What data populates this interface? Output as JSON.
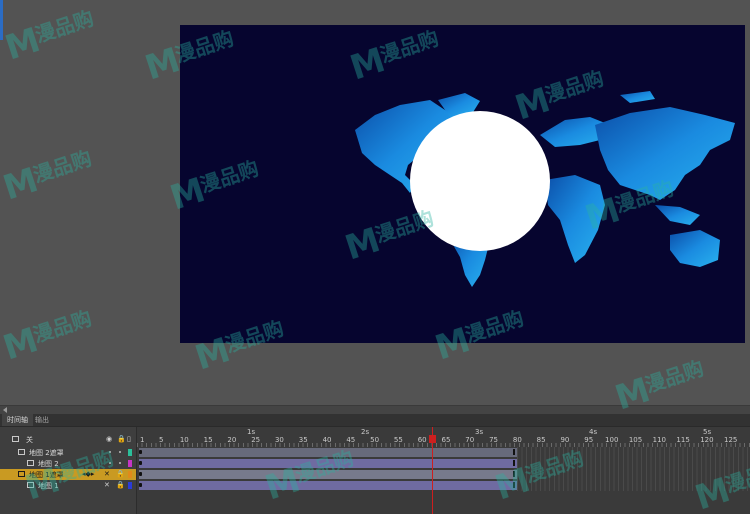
{
  "canvas": {
    "background": "#06052f",
    "circle_color": "#ffffff",
    "map_color": "#1e86d6"
  },
  "panel": {
    "tabs": [
      {
        "label": "时间轴"
      },
      {
        "label": "输出"
      }
    ]
  },
  "timeline": {
    "header_label": "关",
    "seconds": [
      "1s",
      "2s",
      "3s",
      "4s",
      "5s"
    ],
    "frame_numbers": [
      "1",
      "5",
      "10",
      "15",
      "20",
      "25",
      "30",
      "35",
      "40",
      "45",
      "50",
      "55",
      "60",
      "65",
      "70",
      "75",
      "80",
      "85",
      "90",
      "95",
      "100",
      "105",
      "110",
      "115",
      "120",
      "125"
    ],
    "layers": [
      {
        "name": "地图 2遮罩",
        "color": "#2bbf9a",
        "selected": false,
        "indent": 0
      },
      {
        "name": "地图 2",
        "color": "#c535c5",
        "selected": false,
        "indent": 1
      },
      {
        "name": "地图 1遮罩",
        "color": "#e08a1a",
        "selected": true,
        "indent": 0
      },
      {
        "name": "地图 1",
        "color": "#2a3bd8",
        "selected": false,
        "indent": 1
      }
    ],
    "span_colors": [
      "#676a7b",
      "#6f6ba1",
      "#777a8c",
      "#6f6ba1"
    ],
    "current_frame": 63,
    "last_frame": 80
  },
  "watermark": {
    "text": "漫品购",
    "color": "#2ab3a0"
  }
}
